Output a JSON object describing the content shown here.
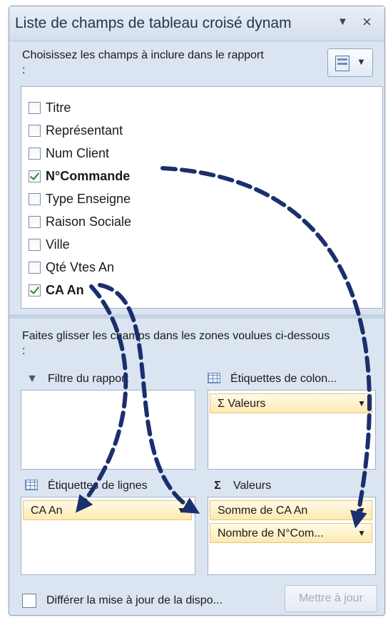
{
  "panel": {
    "title": "Liste de champs de tableau croisé dynam",
    "dropdown_icon": "dropdown-arrow-icon",
    "close_icon": "close-icon"
  },
  "field_section": {
    "prompt": "Choisissez les champs à inclure dans le rapport :",
    "layout_button_icon": "field-list-layout-icon",
    "fields": [
      {
        "label": "Titre",
        "checked": false
      },
      {
        "label": "Représentant",
        "checked": false
      },
      {
        "label": "Num Client",
        "checked": false
      },
      {
        "label": "N°Commande",
        "checked": true
      },
      {
        "label": "Type Enseigne",
        "checked": false
      },
      {
        "label": "Raison Sociale",
        "checked": false
      },
      {
        "label": "Ville",
        "checked": false
      },
      {
        "label": "Qté Vtes An",
        "checked": false
      },
      {
        "label": "CA An",
        "checked": true
      }
    ]
  },
  "areas_section": {
    "instruction": "Faites glisser les champs dans les zones voulues ci-dessous :",
    "report_filter": {
      "label": "Filtre du rapport",
      "icon": "filter-icon"
    },
    "column_labels": {
      "label": "Étiquettes de colon...",
      "icon": "column-labels-icon",
      "items": [
        "Σ  Valeurs"
      ]
    },
    "row_labels": {
      "label": "Étiquettes de lignes",
      "icon": "row-labels-icon",
      "items": [
        "CA An"
      ]
    },
    "values": {
      "label": "Valeurs",
      "icon": "sigma-icon",
      "items": [
        "Somme de CA An",
        "Nombre de N°Com..."
      ]
    }
  },
  "footer": {
    "defer_label": "Différer la mise à jour de la dispo...",
    "defer_checked": false,
    "update_button": "Mettre à jour"
  },
  "colors": {
    "panel_bg": "#dbe5f1",
    "pill_bg": "#fde9b0",
    "arrow": "#1b2f6e"
  }
}
